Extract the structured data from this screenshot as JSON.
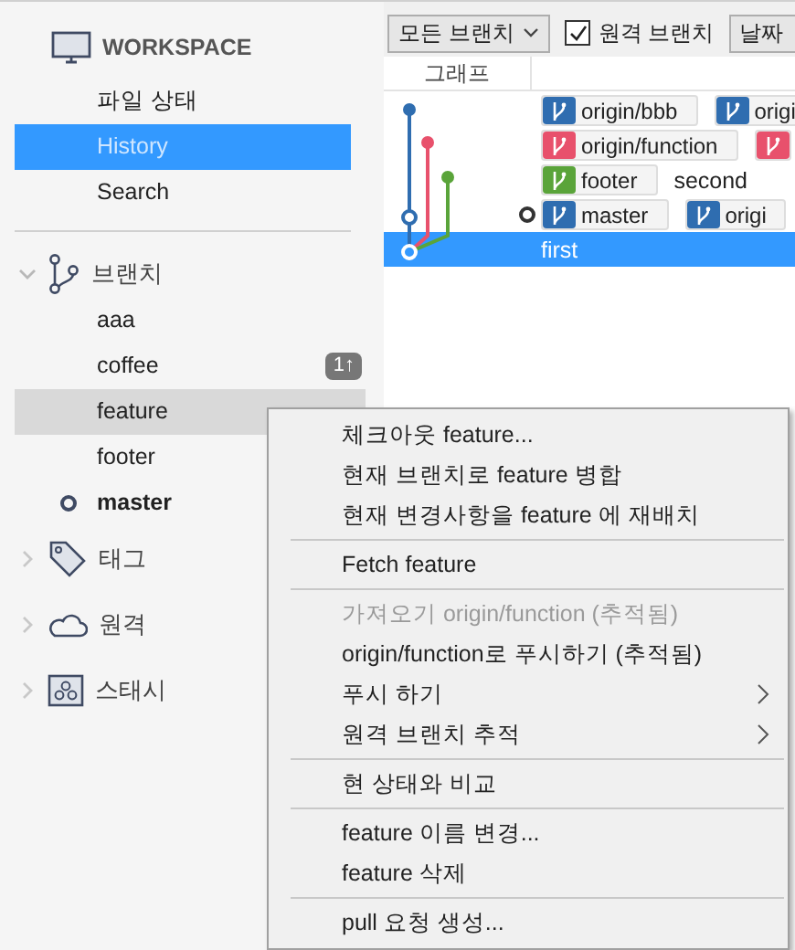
{
  "sidebar": {
    "workspace": {
      "title": "WORKSPACE",
      "items": [
        {
          "label": "파일 상태",
          "selected": false
        },
        {
          "label": "History",
          "selected": true
        },
        {
          "label": "Search",
          "selected": false
        }
      ]
    },
    "branches": {
      "title": "브랜치",
      "expanded": true,
      "items": [
        {
          "label": "aaa",
          "selected": false,
          "current": false
        },
        {
          "label": "coffee",
          "selected": false,
          "current": false,
          "badge": "1↑"
        },
        {
          "label": "feature",
          "selected": true,
          "current": false
        },
        {
          "label": "footer",
          "selected": false,
          "current": false
        },
        {
          "label": "master",
          "selected": false,
          "current": true
        }
      ]
    },
    "sections": [
      {
        "kind": "tag",
        "title": "태그",
        "expanded": false
      },
      {
        "kind": "remote",
        "title": "원격",
        "expanded": false
      },
      {
        "kind": "stash",
        "title": "스태시",
        "expanded": false
      }
    ]
  },
  "toolbar": {
    "branch_filter": "모든 브랜치",
    "remote_branches": {
      "label": "원격 브랜치",
      "checked": true
    },
    "sort_button": "날짜"
  },
  "history": {
    "columns": [
      "그래프"
    ],
    "rows": [
      {
        "selected": false,
        "head": false,
        "refs": [
          {
            "label": "origin/bbb",
            "color": "#2f6db0"
          },
          {
            "label": "origi",
            "color": "#2f6db0"
          }
        ]
      },
      {
        "selected": false,
        "head": false,
        "refs": [
          {
            "label": "origin/function",
            "color": "#e8516c"
          },
          {
            "color": "#e8516c"
          }
        ]
      },
      {
        "selected": false,
        "head": false,
        "refs": [
          {
            "label": "footer",
            "color": "#5aa43a"
          }
        ],
        "message": "second"
      },
      {
        "selected": false,
        "head": true,
        "refs": [
          {
            "label": "master",
            "color": "#2f6db0"
          },
          {
            "label": "origi",
            "color": "#2f6db0"
          }
        ]
      },
      {
        "selected": true,
        "head": false,
        "refs": [],
        "message": "first"
      }
    ]
  },
  "context_menu": {
    "groups": [
      [
        {
          "label": "체크아웃 feature...",
          "disabled": false,
          "submenu": false
        },
        {
          "label": "현재 브랜치로 feature 병합",
          "disabled": false,
          "submenu": false
        },
        {
          "label": "현재 변경사항을 feature 에 재배치",
          "disabled": false,
          "submenu": false
        }
      ],
      [
        {
          "label": "Fetch feature",
          "disabled": false,
          "submenu": false
        }
      ],
      [
        {
          "label": "가져오기 origin/function (추적됨)",
          "disabled": true,
          "submenu": false
        },
        {
          "label": "origin/function로 푸시하기 (추적됨)",
          "disabled": false,
          "submenu": false
        },
        {
          "label": "푸시 하기",
          "disabled": false,
          "submenu": true
        },
        {
          "label": "원격 브랜치 추적",
          "disabled": false,
          "submenu": true
        }
      ],
      [
        {
          "label": "현 상태와 비교",
          "disabled": false,
          "submenu": false
        }
      ],
      [
        {
          "label": "feature 이름 변경...",
          "disabled": false,
          "submenu": false
        },
        {
          "label": "feature 삭제",
          "disabled": false,
          "submenu": false
        }
      ],
      [
        {
          "label": "pull 요청 생성...",
          "disabled": false,
          "submenu": false
        }
      ]
    ]
  }
}
